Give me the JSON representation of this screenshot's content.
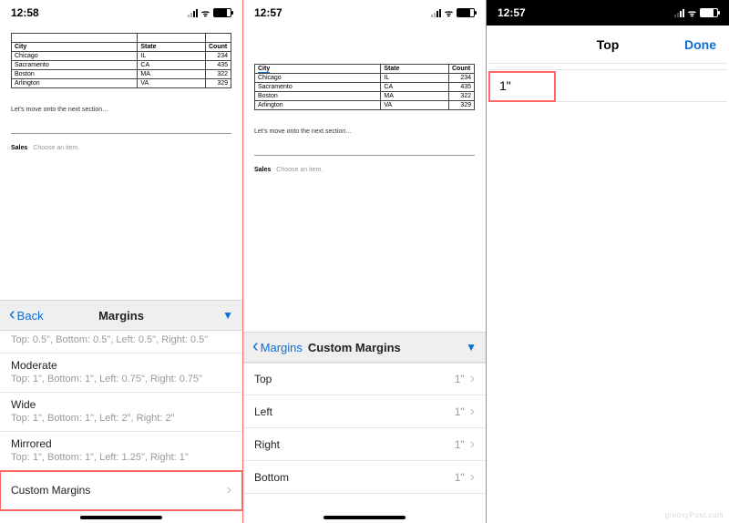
{
  "status": {
    "t1": "12:58",
    "t2": "12:57",
    "t3": "12:57"
  },
  "table": {
    "headers": [
      "City",
      "State",
      "Count"
    ],
    "rows": [
      [
        "Chicago",
        "IL",
        "234"
      ],
      [
        "Sacramento",
        "CA",
        "435"
      ],
      [
        "Boston",
        "MA",
        "322"
      ],
      [
        "Arlington",
        "VA",
        "329"
      ]
    ]
  },
  "doc": {
    "next_section": "Let's move onto the next section…",
    "sales_label": "Sales",
    "sales_value": "Choose an item."
  },
  "p1": {
    "back": "Back",
    "title": "Margins",
    "truncated_desc": "Top: 0.5\", Bottom: 0.5\", Left: 0.5\", Right: 0.5\"",
    "options": [
      {
        "name": "Moderate",
        "desc": "Top: 1\", Bottom: 1\", Left: 0.75\", Right: 0.75\""
      },
      {
        "name": "Wide",
        "desc": "Top: 1\", Bottom: 1\", Left: 2\", Right: 2\""
      },
      {
        "name": "Mirrored",
        "desc": "Top: 1\", Bottom: 1\", Left: 1.25\", Right: 1\""
      }
    ],
    "custom": "Custom Margins"
  },
  "p2": {
    "back": "Margins",
    "title": "Custom Margins",
    "rows": [
      {
        "label": "Top",
        "value": "1\""
      },
      {
        "label": "Left",
        "value": "1\""
      },
      {
        "label": "Right",
        "value": "1\""
      },
      {
        "label": "Bottom",
        "value": "1\""
      }
    ]
  },
  "p3": {
    "title": "Top",
    "done": "Done",
    "value": "1\""
  }
}
